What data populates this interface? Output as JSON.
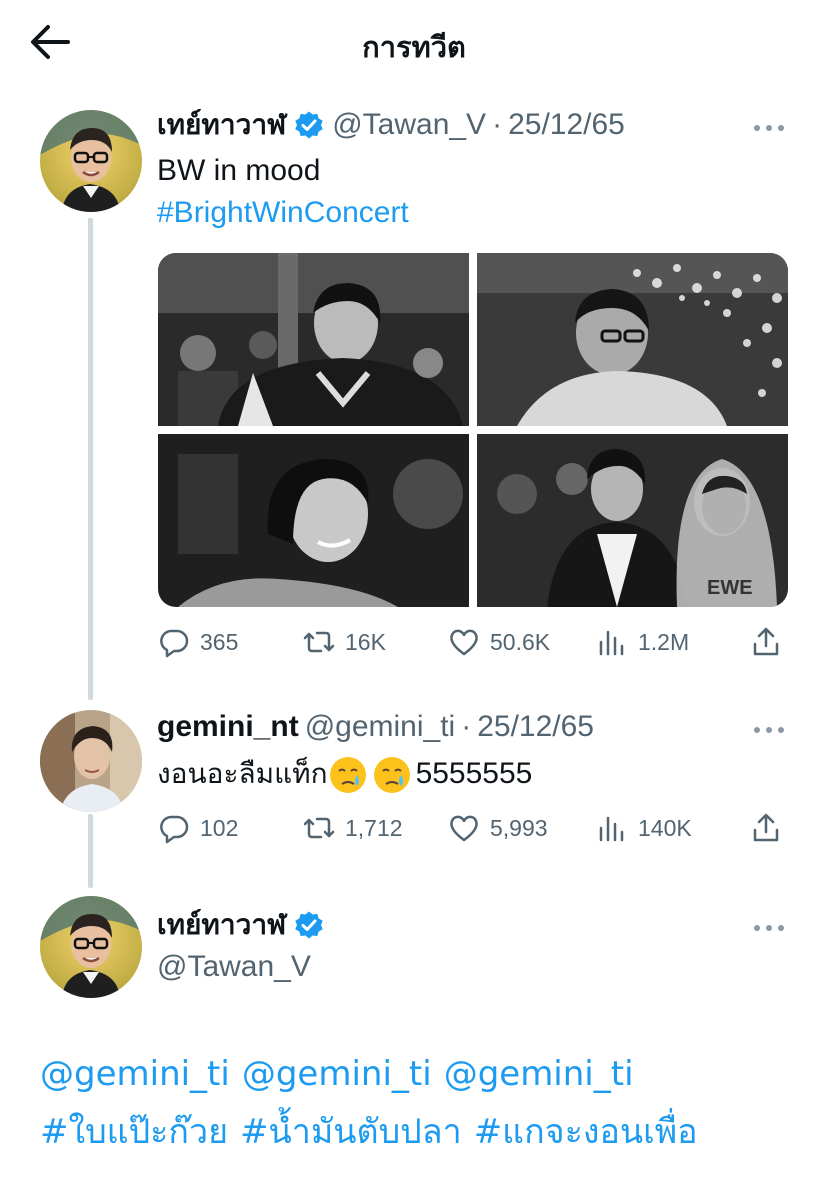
{
  "header": {
    "title": "การทวีต"
  },
  "main_tweet": {
    "display_name": "เทย์ทาวาฬ",
    "handle": "@Tawan_V",
    "separator": "·",
    "time": "25/12/65",
    "text": "BW in mood",
    "hashtag": "#BrightWinConcert",
    "stats": {
      "replies": "365",
      "retweets": "16K",
      "likes": "50.6K",
      "views": "1.2M"
    }
  },
  "reply_tweet": {
    "display_name": "gemini_nt",
    "handle": "@gemini_ti",
    "separator": "·",
    "time": "25/12/65",
    "text": "งอนอะลืมแท็ก",
    "text_suffix": "5555555",
    "stats": {
      "replies": "102",
      "retweets": "1,712",
      "likes": "5,993",
      "views": "140K"
    }
  },
  "focus_tweet": {
    "display_name": "เทย์ทาวาฬ",
    "handle": "@Tawan_V",
    "mentions": [
      "@gemini_ti",
      "@gemini_ti",
      "@gemini_ti"
    ],
    "hashtags": [
      "#ใบแป๊ะก๊วย",
      "#น้ำมันตับปลา",
      "#แกจะงอนเพื่อ"
    ]
  },
  "icons": {
    "back": "arrow-left-icon",
    "verified": "verified-badge-icon",
    "more": "more-dots-icon",
    "reply": "reply-icon",
    "retweet": "retweet-icon",
    "like": "heart-icon",
    "views": "views-bar-icon",
    "share": "share-icon",
    "emoji": "crying-face-emoji"
  },
  "colors": {
    "link": "#1d9bf0",
    "verified": "#1d9bf0",
    "secondary_text": "#536471",
    "thread_line": "#cfd9de"
  }
}
